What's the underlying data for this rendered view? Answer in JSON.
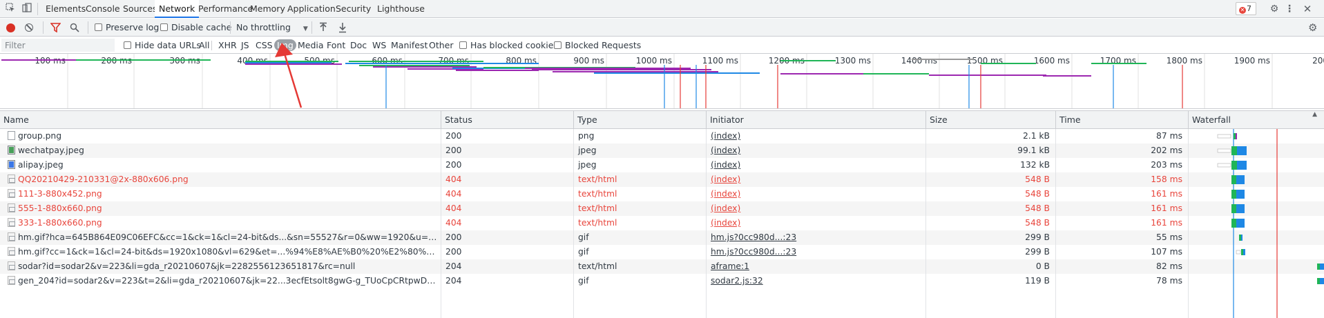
{
  "devtools_tabs": [
    "Elements",
    "Console",
    "Sources",
    "Network",
    "Performance",
    "Memory",
    "Application",
    "Security",
    "Lighthouse"
  ],
  "active_tab": "Network",
  "error_count": "7",
  "toolbar": {
    "preserve_log": "Preserve log",
    "disable_cache": "Disable cache",
    "throttling": "No throttling"
  },
  "filterbar": {
    "filter_placeholder": "Filter",
    "hide_data_urls": "Hide data URLs",
    "types": [
      "All",
      "XHR",
      "JS",
      "CSS",
      "Img",
      "Media",
      "Font",
      "Doc",
      "WS",
      "Manifest",
      "Other"
    ],
    "active_type": "Img",
    "has_blocked_cookies": "Has blocked cookies",
    "blocked_requests": "Blocked Requests"
  },
  "overview_ticks": [
    "100 ms",
    "200 ms",
    "300 ms",
    "400 ms",
    "500 ms",
    "600 ms",
    "700 ms",
    "800 ms",
    "900 ms",
    "1000 ms",
    "1100 ms",
    "1200 ms",
    "1300 ms",
    "1400 ms",
    "1500 ms",
    "1600 ms",
    "1700 ms",
    "1800 ms",
    "1900 ms",
    "200"
  ],
  "columns": [
    "Name",
    "Status",
    "Type",
    "Initiator",
    "Size",
    "Time",
    "Waterfall"
  ],
  "requests": [
    {
      "name": "group.png",
      "status": "200",
      "type": "png",
      "initiator": "(index)",
      "size": "2.1 kB",
      "time": "87 ms",
      "icon": "blank",
      "error": false
    },
    {
      "name": "wechatpay.jpeg",
      "status": "200",
      "type": "jpeg",
      "initiator": "(index)",
      "size": "99.1 kB",
      "time": "202 ms",
      "icon": "img-green",
      "error": false
    },
    {
      "name": "alipay.jpeg",
      "status": "200",
      "type": "jpeg",
      "initiator": "(index)",
      "size": "132 kB",
      "time": "203 ms",
      "icon": "img-blue",
      "error": false
    },
    {
      "name": "QQ20210429-210331@2x-880x606.png",
      "status": "404",
      "type": "text/html",
      "initiator": "(index)",
      "size": "548 B",
      "time": "158 ms",
      "icon": "broken",
      "error": true
    },
    {
      "name": "111-3-880x452.png",
      "status": "404",
      "type": "text/html",
      "initiator": "(index)",
      "size": "548 B",
      "time": "161 ms",
      "icon": "broken",
      "error": true
    },
    {
      "name": "555-1-880x660.png",
      "status": "404",
      "type": "text/html",
      "initiator": "(index)",
      "size": "548 B",
      "time": "161 ms",
      "icon": "broken",
      "error": true
    },
    {
      "name": "333-1-880x660.png",
      "status": "404",
      "type": "text/html",
      "initiator": "(index)",
      "size": "548 B",
      "time": "161 ms",
      "icon": "broken",
      "error": true
    },
    {
      "name": "hm.gif?hca=645B864E09C06EFC&cc=1&ck=1&cl=24-bit&ds...&sn=55527&r=0&ww=1920&u=https%3A%2F%2F...",
      "status": "200",
      "type": "gif",
      "initiator": "hm.js?0cc980d...:23",
      "size": "299 B",
      "time": "55 ms",
      "icon": "broken",
      "error": false
    },
    {
      "name": "hm.gif?cc=1&ck=1&cl=24-bit&ds=1920x1080&vl=629&et=...%94%E8%AE%B0%20%E2%80%93%20MQTT%E6%...",
      "status": "200",
      "type": "gif",
      "initiator": "hm.js?0cc980d...:23",
      "size": "299 B",
      "time": "107 ms",
      "icon": "broken",
      "error": false
    },
    {
      "name": "sodar?id=sodar2&v=223&li=gda_r20210607&jk=2282556123651817&rc=null",
      "status": "204",
      "type": "text/html",
      "initiator": "aframe:1",
      "size": "0 B",
      "time": "82 ms",
      "icon": "broken",
      "error": false
    },
    {
      "name": "gen_204?id=sodar2&v=223&t=2&li=gda_r20210607&jk=22...3ecfEtsolt8gwG-g_TUoCpCRtpwD41xvFLAhWzatmv...",
      "status": "204",
      "type": "gif",
      "initiator": "sodar2.js:32",
      "size": "119 B",
      "time": "78 ms",
      "icon": "broken",
      "error": false
    }
  ],
  "colors": {
    "accent": "#1a73e8",
    "error_text": "#e8453c",
    "waterfall_green": "#1fb557",
    "waterfall_blue": "#1e88e5",
    "overview_purple": "#9c27b0",
    "overview_green": "#1fb557",
    "overview_blue": "#1e88e5",
    "marker_red": "#e53935",
    "marker_blue": "#1e88e5",
    "annotation_arrow": "#e53935"
  },
  "icons": {
    "inspect": "cursor-select-icon",
    "device": "device-toolbar-icon",
    "record": "record-icon",
    "clear": "clear-icon",
    "filter": "filter-icon",
    "search": "search-icon",
    "upload": "import-icon",
    "download": "export-icon",
    "settings": "gear-icon",
    "more": "kebab-icon"
  }
}
